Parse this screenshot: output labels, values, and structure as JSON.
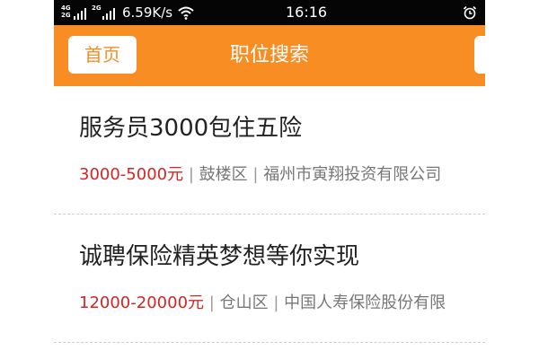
{
  "status_bar": {
    "network_top": "4G",
    "network_bottom": "2G",
    "network_top_2": "2G",
    "network_bottom_2": "",
    "speed": "6.59K/s",
    "time": "16:16",
    "wifi_icon": "wifi-icon",
    "alarm_icon": "alarm-icon"
  },
  "header": {
    "home_label": "首页",
    "title": "职位搜索",
    "background": "#f88d24"
  },
  "jobs": [
    {
      "title": "服务员3000包住五险",
      "salary": "3000-5000元",
      "separator": "|",
      "district": "鼓楼区",
      "company": "福州市寅翔投资有限公司"
    },
    {
      "title": "诚聘保险精英梦想等你实现",
      "salary": "12000-20000元",
      "separator": "|",
      "district": "仓山区",
      "company": "中国人寿保险股份有限"
    }
  ],
  "colors": {
    "accent": "#f88d24",
    "salary": "#d42424",
    "status_bar": "#050505"
  }
}
